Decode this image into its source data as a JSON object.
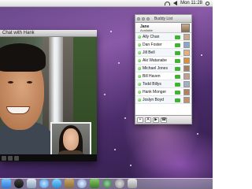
{
  "menubar": {
    "day_time": "Mon 11:28",
    "icons": [
      "spotlight-icon",
      "volume-icon",
      "wifi-icon"
    ]
  },
  "chat_window": {
    "title": "Chat with Hank"
  },
  "buddy_list": {
    "title": "Buddy List",
    "me": {
      "name": "Jane",
      "status": "Available"
    },
    "buddies": [
      {
        "name": "Ally Chan",
        "avatar_color": "#c9a98a"
      },
      {
        "name": "Dan Foster",
        "avatar_color": "#8aa7c9"
      },
      {
        "name": "Jill Bell",
        "avatar_color": "#e0b080"
      },
      {
        "name": "Aki Watanabe",
        "avatar_color": "#d99040"
      },
      {
        "name": "Michael Jones",
        "avatar_color": "#a08060"
      },
      {
        "name": "Bill Haven",
        "avatar_color": "#c0a090"
      },
      {
        "name": "Todd Billys",
        "avatar_color": "#a0b0c0"
      },
      {
        "name": "Hank Monger",
        "avatar_color": "#b08060"
      },
      {
        "name": "Joslyn Boyd",
        "avatar_color": "#c09070"
      }
    ],
    "toolbar": [
      "+",
      "A",
      "▶",
      "☎"
    ]
  },
  "colors": {
    "status_available": "#3db51c",
    "camera_green": "#3fb430"
  },
  "dock": {
    "icons": [
      "finder-icon",
      "dashboard-icon",
      "mail-icon",
      "safari-icon",
      "ichat-icon",
      "addressbook-icon",
      "itunes-icon",
      "iphoto-icon",
      "timemachine-icon",
      "preferences-icon",
      "trash-icon"
    ]
  }
}
